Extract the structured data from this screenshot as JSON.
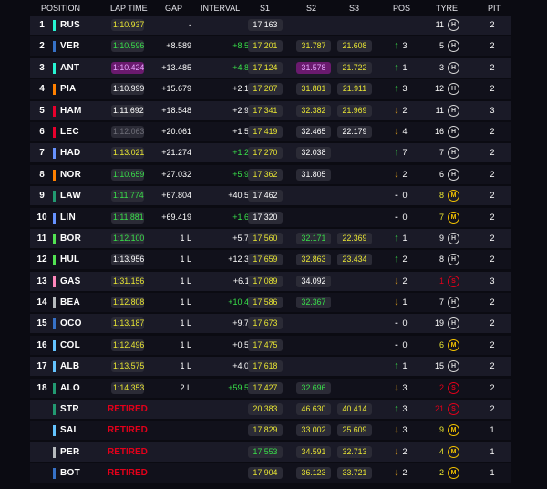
{
  "headers": {
    "position": "POSITION",
    "lap_time": "LAP TIME",
    "gap": "GAP",
    "interval": "INTERVAL",
    "s1": "S1",
    "s2": "S2",
    "s3": "S3",
    "pos": "POS",
    "tyre": "TYRE",
    "pit": "PIT"
  },
  "rows": [
    {
      "pos": "1",
      "team_color": "#27f4d2",
      "driver": "RUS",
      "lap": "1:10.937",
      "lap_style": "yellow",
      "gap": "-",
      "gap_style": "white",
      "interval": "-",
      "int_style": "white",
      "s1": "17.163",
      "s1_style": "white",
      "s2": "",
      "s2_style": "white",
      "s3": "",
      "s3_style": "white",
      "arrow": "",
      "arrow_dir": "none",
      "pos_change": "",
      "tyre_age": "11",
      "tyre_age_style": "white",
      "tyre_compound": "H",
      "tyre_color": "#d8d8d8",
      "pit": "2"
    },
    {
      "pos": "2",
      "team_color": "#3671c6",
      "driver": "VER",
      "lap": "1:10.596",
      "lap_style": "green",
      "gap": "+8.589",
      "gap_style": "white",
      "interval": "+8.589",
      "int_style": "green",
      "s1": "17.201",
      "s1_style": "yellow",
      "s2": "31.787",
      "s2_style": "yellow",
      "s3": "21.608",
      "s3_style": "yellow",
      "arrow": "↑",
      "arrow_dir": "up",
      "pos_change": "3",
      "tyre_age": "5",
      "tyre_age_style": "white",
      "tyre_compound": "H",
      "tyre_color": "#d8d8d8",
      "pit": "2"
    },
    {
      "pos": "3",
      "team_color": "#27f4d2",
      "driver": "ANT",
      "lap": "1:10.424",
      "lap_style": "purple",
      "gap": "+13.485",
      "gap_style": "white",
      "interval": "+4.819",
      "int_style": "green",
      "s1": "17.124",
      "s1_style": "yellow",
      "s2": "31.578",
      "s2_style": "purple",
      "s3": "21.722",
      "s3_style": "yellow",
      "arrow": "↑",
      "arrow_dir": "up",
      "pos_change": "1",
      "tyre_age": "3",
      "tyre_age_style": "white",
      "tyre_compound": "H",
      "tyre_color": "#d8d8d8",
      "pit": "2"
    },
    {
      "pos": "4",
      "team_color": "#ff8000",
      "driver": "PIA",
      "lap": "1:10.999",
      "lap_style": "white",
      "gap": "+15.679",
      "gap_style": "white",
      "interval": "+2.194",
      "int_style": "white",
      "s1": "17.207",
      "s1_style": "yellow",
      "s2": "31.881",
      "s2_style": "yellow",
      "s3": "21.911",
      "s3_style": "yellow",
      "arrow": "↑",
      "arrow_dir": "up",
      "pos_change": "3",
      "tyre_age": "12",
      "tyre_age_style": "white",
      "tyre_compound": "H",
      "tyre_color": "#d8d8d8",
      "pit": "2"
    },
    {
      "pos": "5",
      "team_color": "#e8002d",
      "driver": "HAM",
      "lap": "1:11.692",
      "lap_style": "white",
      "gap": "+18.548",
      "gap_style": "white",
      "interval": "+2.905",
      "int_style": "white",
      "s1": "17.341",
      "s1_style": "yellow",
      "s2": "32.382",
      "s2_style": "yellow",
      "s3": "21.969",
      "s3_style": "yellow",
      "arrow": "↓",
      "arrow_dir": "down",
      "pos_change": "2",
      "tyre_age": "11",
      "tyre_age_style": "white",
      "tyre_compound": "H",
      "tyre_color": "#d8d8d8",
      "pit": "3"
    },
    {
      "pos": "6",
      "team_color": "#e8002d",
      "driver": "LEC",
      "lap": "1:12.063",
      "lap_style": "dim",
      "gap": "+20.061",
      "gap_style": "white",
      "interval": "+1.513",
      "int_style": "white",
      "s1": "17.419",
      "s1_style": "yellow",
      "s2": "32.465",
      "s2_style": "white",
      "s3": "22.179",
      "s3_style": "white",
      "arrow": "↓",
      "arrow_dir": "down",
      "pos_change": "4",
      "tyre_age": "16",
      "tyre_age_style": "white",
      "tyre_compound": "H",
      "tyre_color": "#d8d8d8",
      "pit": "2"
    },
    {
      "pos": "7",
      "team_color": "#6692ff",
      "driver": "HAD",
      "lap": "1:13.021",
      "lap_style": "yellow",
      "gap": "+21.274",
      "gap_style": "white",
      "interval": "+1.240",
      "int_style": "green",
      "s1": "17.270",
      "s1_style": "yellow",
      "s2": "32.038",
      "s2_style": "white",
      "s3": "",
      "s3_style": "white",
      "arrow": "↑",
      "arrow_dir": "up",
      "pos_change": "7",
      "tyre_age": "7",
      "tyre_age_style": "white",
      "tyre_compound": "H",
      "tyre_color": "#d8d8d8",
      "pit": "2"
    },
    {
      "pos": "8",
      "team_color": "#ff8000",
      "driver": "NOR",
      "lap": "1:10.659",
      "lap_style": "green",
      "gap": "+27.032",
      "gap_style": "white",
      "interval": "+5.947",
      "int_style": "green",
      "s1": "17.362",
      "s1_style": "yellow",
      "s2": "31.805",
      "s2_style": "white",
      "s3": "",
      "s3_style": "white",
      "arrow": "↓",
      "arrow_dir": "down",
      "pos_change": "2",
      "tyre_age": "6",
      "tyre_age_style": "white",
      "tyre_compound": "H",
      "tyre_color": "#d8d8d8",
      "pit": "2"
    },
    {
      "pos": "9",
      "team_color": "#229971",
      "driver": "LAW",
      "lap": "1:11.774",
      "lap_style": "green",
      "gap": "+67.804",
      "gap_style": "white",
      "interval": "+40.547",
      "int_style": "white",
      "s1": "17.462",
      "s1_style": "white",
      "s2": "",
      "s2_style": "white",
      "s3": "",
      "s3_style": "white",
      "arrow": "-",
      "arrow_dir": "flat",
      "pos_change": "0",
      "tyre_age": "8",
      "tyre_age_style": "yellow",
      "tyre_compound": "M",
      "tyre_color": "#f2c200",
      "pit": "2"
    },
    {
      "pos": "10",
      "team_color": "#6692ff",
      "driver": "LIN",
      "lap": "1:11.881",
      "lap_style": "green",
      "gap": "+69.419",
      "gap_style": "white",
      "interval": "+1.615",
      "int_style": "green",
      "s1": "17.320",
      "s1_style": "white",
      "s2": "",
      "s2_style": "white",
      "s3": "",
      "s3_style": "white",
      "arrow": "-",
      "arrow_dir": "flat",
      "pos_change": "0",
      "tyre_age": "7",
      "tyre_age_style": "yellow",
      "tyre_compound": "M",
      "tyre_color": "#f2c200",
      "pit": "2"
    },
    {
      "pos": "11",
      "team_color": "#52e252",
      "driver": "BOR",
      "lap": "1:12.100",
      "lap_style": "green",
      "gap": "1 L",
      "gap_style": "white",
      "interval": "+5.786",
      "int_style": "white",
      "s1": "17.560",
      "s1_style": "yellow",
      "s2": "32.171",
      "s2_style": "green",
      "s3": "22.369",
      "s3_style": "yellow",
      "arrow": "↑",
      "arrow_dir": "up",
      "pos_change": "1",
      "tyre_age": "9",
      "tyre_age_style": "white",
      "tyre_compound": "H",
      "tyre_color": "#d8d8d8",
      "pit": "2"
    },
    {
      "pos": "12",
      "team_color": "#52e252",
      "driver": "HUL",
      "lap": "1:13.956",
      "lap_style": "white",
      "gap": "1 L",
      "gap_style": "white",
      "interval": "+12.371",
      "int_style": "white",
      "s1": "17.659",
      "s1_style": "yellow",
      "s2": "32.863",
      "s2_style": "yellow",
      "s3": "23.434",
      "s3_style": "yellow",
      "arrow": "↑",
      "arrow_dir": "up",
      "pos_change": "2",
      "tyre_age": "8",
      "tyre_age_style": "white",
      "tyre_compound": "H",
      "tyre_color": "#d8d8d8",
      "pit": "2"
    },
    {
      "pos": "13",
      "team_color": "#ff87bc",
      "driver": "GAS",
      "lap": "1:31.156",
      "lap_style": "yellow",
      "gap": "1 L",
      "gap_style": "white",
      "interval": "+6.114",
      "int_style": "white",
      "s1": "17.089",
      "s1_style": "yellow",
      "s2": "34.092",
      "s2_style": "white",
      "s3": "",
      "s3_style": "white",
      "arrow": "↓",
      "arrow_dir": "down",
      "pos_change": "2",
      "tyre_age": "1",
      "tyre_age_style": "red",
      "tyre_compound": "S",
      "tyre_color": "#e2001a",
      "pit": "3"
    },
    {
      "pos": "14",
      "team_color": "#b6babd",
      "driver": "BEA",
      "lap": "1:12.808",
      "lap_style": "yellow",
      "gap": "1 L",
      "gap_style": "white",
      "interval": "+10.495",
      "int_style": "green",
      "s1": "17.586",
      "s1_style": "yellow",
      "s2": "32.367",
      "s2_style": "green",
      "s3": "",
      "s3_style": "white",
      "arrow": "↓",
      "arrow_dir": "down",
      "pos_change": "1",
      "tyre_age": "7",
      "tyre_age_style": "white",
      "tyre_compound": "H",
      "tyre_color": "#d8d8d8",
      "pit": "2"
    },
    {
      "pos": "15",
      "team_color": "#3671c6",
      "driver": "OCO",
      "lap": "1:13.187",
      "lap_style": "yellow",
      "gap": "1 L",
      "gap_style": "white",
      "interval": "+9.758",
      "int_style": "white",
      "s1": "17.673",
      "s1_style": "yellow",
      "s2": "",
      "s2_style": "white",
      "s3": "",
      "s3_style": "white",
      "arrow": "-",
      "arrow_dir": "flat",
      "pos_change": "0",
      "tyre_age": "19",
      "tyre_age_style": "white",
      "tyre_compound": "H",
      "tyre_color": "#d8d8d8",
      "pit": "2"
    },
    {
      "pos": "16",
      "team_color": "#64c4ff",
      "driver": "COL",
      "lap": "1:12.496",
      "lap_style": "yellow",
      "gap": "1 L",
      "gap_style": "white",
      "interval": "+0.543",
      "int_style": "white",
      "s1": "17.475",
      "s1_style": "yellow",
      "s2": "",
      "s2_style": "white",
      "s3": "",
      "s3_style": "white",
      "arrow": "-",
      "arrow_dir": "flat",
      "pos_change": "0",
      "tyre_age": "6",
      "tyre_age_style": "yellow",
      "tyre_compound": "M",
      "tyre_color": "#f2c200",
      "pit": "2"
    },
    {
      "pos": "17",
      "team_color": "#64c4ff",
      "driver": "ALB",
      "lap": "1:13.575",
      "lap_style": "yellow",
      "gap": "1 L",
      "gap_style": "white",
      "interval": "+4.090",
      "int_style": "white",
      "s1": "17.618",
      "s1_style": "yellow",
      "s2": "",
      "s2_style": "white",
      "s3": "",
      "s3_style": "white",
      "arrow": "↑",
      "arrow_dir": "up",
      "pos_change": "1",
      "tyre_age": "15",
      "tyre_age_style": "white",
      "tyre_compound": "H",
      "tyre_color": "#d8d8d8",
      "pit": "2"
    },
    {
      "pos": "18",
      "team_color": "#229971",
      "driver": "ALO",
      "lap": "1:14.353",
      "lap_style": "yellow",
      "gap": "2 L",
      "gap_style": "white",
      "interval": "+59.590",
      "int_style": "green",
      "s1": "17.427",
      "s1_style": "yellow",
      "s2": "32.696",
      "s2_style": "green",
      "s3": "",
      "s3_style": "white",
      "arrow": "↓",
      "arrow_dir": "down",
      "pos_change": "3",
      "tyre_age": "2",
      "tyre_age_style": "red",
      "tyre_compound": "S",
      "tyre_color": "#e2001a",
      "pit": "2"
    },
    {
      "pos": "",
      "team_color": "#229971",
      "driver": "STR",
      "retired": "RETIRED",
      "lap_style": "retired",
      "s1": "20.383",
      "s1_style": "yellow",
      "s2": "46.630",
      "s2_style": "yellow",
      "s3": "40.414",
      "s3_style": "yellow",
      "arrow": "↑",
      "arrow_dir": "up",
      "pos_change": "3",
      "tyre_age": "21",
      "tyre_age_style": "red",
      "tyre_compound": "S",
      "tyre_color": "#e2001a",
      "pit": "2"
    },
    {
      "pos": "",
      "team_color": "#64c4ff",
      "driver": "SAI",
      "retired": "RETIRED",
      "lap_style": "retired",
      "s1": "17.829",
      "s1_style": "yellow",
      "s2": "33.002",
      "s2_style": "yellow",
      "s3": "25.609",
      "s3_style": "yellow",
      "arrow": "↓",
      "arrow_dir": "down",
      "pos_change": "3",
      "tyre_age": "9",
      "tyre_age_style": "yellow",
      "tyre_compound": "M",
      "tyre_color": "#f2c200",
      "pit": "1"
    },
    {
      "pos": "",
      "team_color": "#b6babd",
      "driver": "PER",
      "retired": "RETIRED",
      "lap_style": "retired",
      "s1": "17.553",
      "s1_style": "green",
      "s2": "34.591",
      "s2_style": "yellow",
      "s3": "32.713",
      "s3_style": "yellow",
      "arrow": "↓",
      "arrow_dir": "down",
      "pos_change": "2",
      "tyre_age": "4",
      "tyre_age_style": "yellow",
      "tyre_compound": "M",
      "tyre_color": "#f2c200",
      "pit": "1"
    },
    {
      "pos": "",
      "team_color": "#3671c6",
      "driver": "BOT",
      "retired": "RETIRED",
      "lap_style": "retired",
      "s1": "17.904",
      "s1_style": "yellow",
      "s2": "36.123",
      "s2_style": "yellow",
      "s3": "33.721",
      "s3_style": "yellow",
      "arrow": "↓",
      "arrow_dir": "down",
      "pos_change": "2",
      "tyre_age": "2",
      "tyre_age_style": "yellow",
      "tyre_compound": "M",
      "tyre_color": "#f2c200",
      "pit": "1"
    }
  ]
}
